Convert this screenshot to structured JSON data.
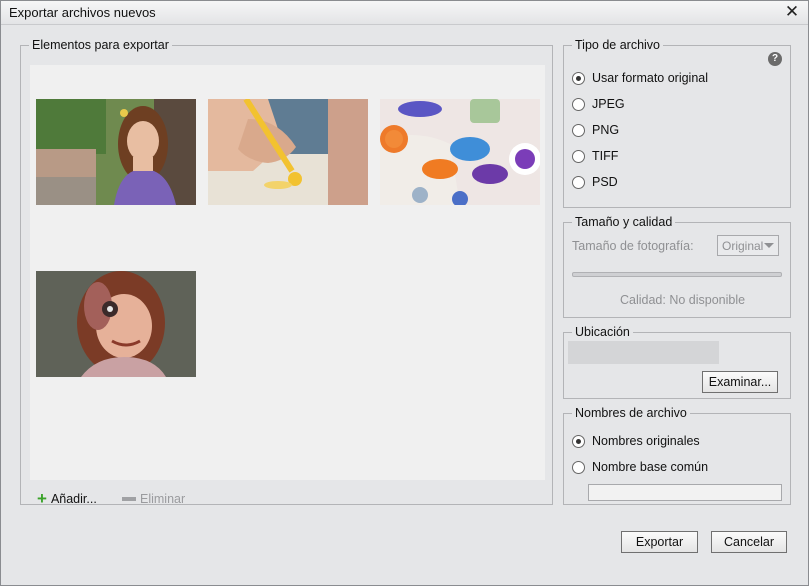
{
  "window": {
    "title": "Exportar archivos nuevos"
  },
  "items_panel": {
    "legend": "Elementos para exportar",
    "add_label": "Añadir...",
    "remove_label": "Eliminar",
    "thumbnails": [
      {
        "name": "girl-portrait"
      },
      {
        "name": "hand-painting"
      },
      {
        "name": "paint-handprints"
      },
      {
        "name": "girl-painted-hand"
      }
    ]
  },
  "file_type": {
    "legend": "Tipo de archivo",
    "help_icon": "help-icon",
    "options": [
      {
        "label": "Usar formato original",
        "selected": true
      },
      {
        "label": "JPEG",
        "selected": false
      },
      {
        "label": "PNG",
        "selected": false
      },
      {
        "label": "TIFF",
        "selected": false
      },
      {
        "label": "PSD",
        "selected": false
      }
    ]
  },
  "size_quality": {
    "legend": "Tamaño y calidad",
    "photo_size_label": "Tamaño de fotografía:",
    "photo_size_value": "Original",
    "quality_text": "Calidad: No disponible"
  },
  "location": {
    "legend": "Ubicación",
    "browse_label": "Examinar..."
  },
  "filenames": {
    "legend": "Nombres de archivo",
    "options": [
      {
        "label": "Nombres originales",
        "selected": true
      },
      {
        "label": "Nombre base común",
        "selected": false
      }
    ],
    "base_name_value": ""
  },
  "footer": {
    "export_label": "Exportar",
    "cancel_label": "Cancelar"
  }
}
